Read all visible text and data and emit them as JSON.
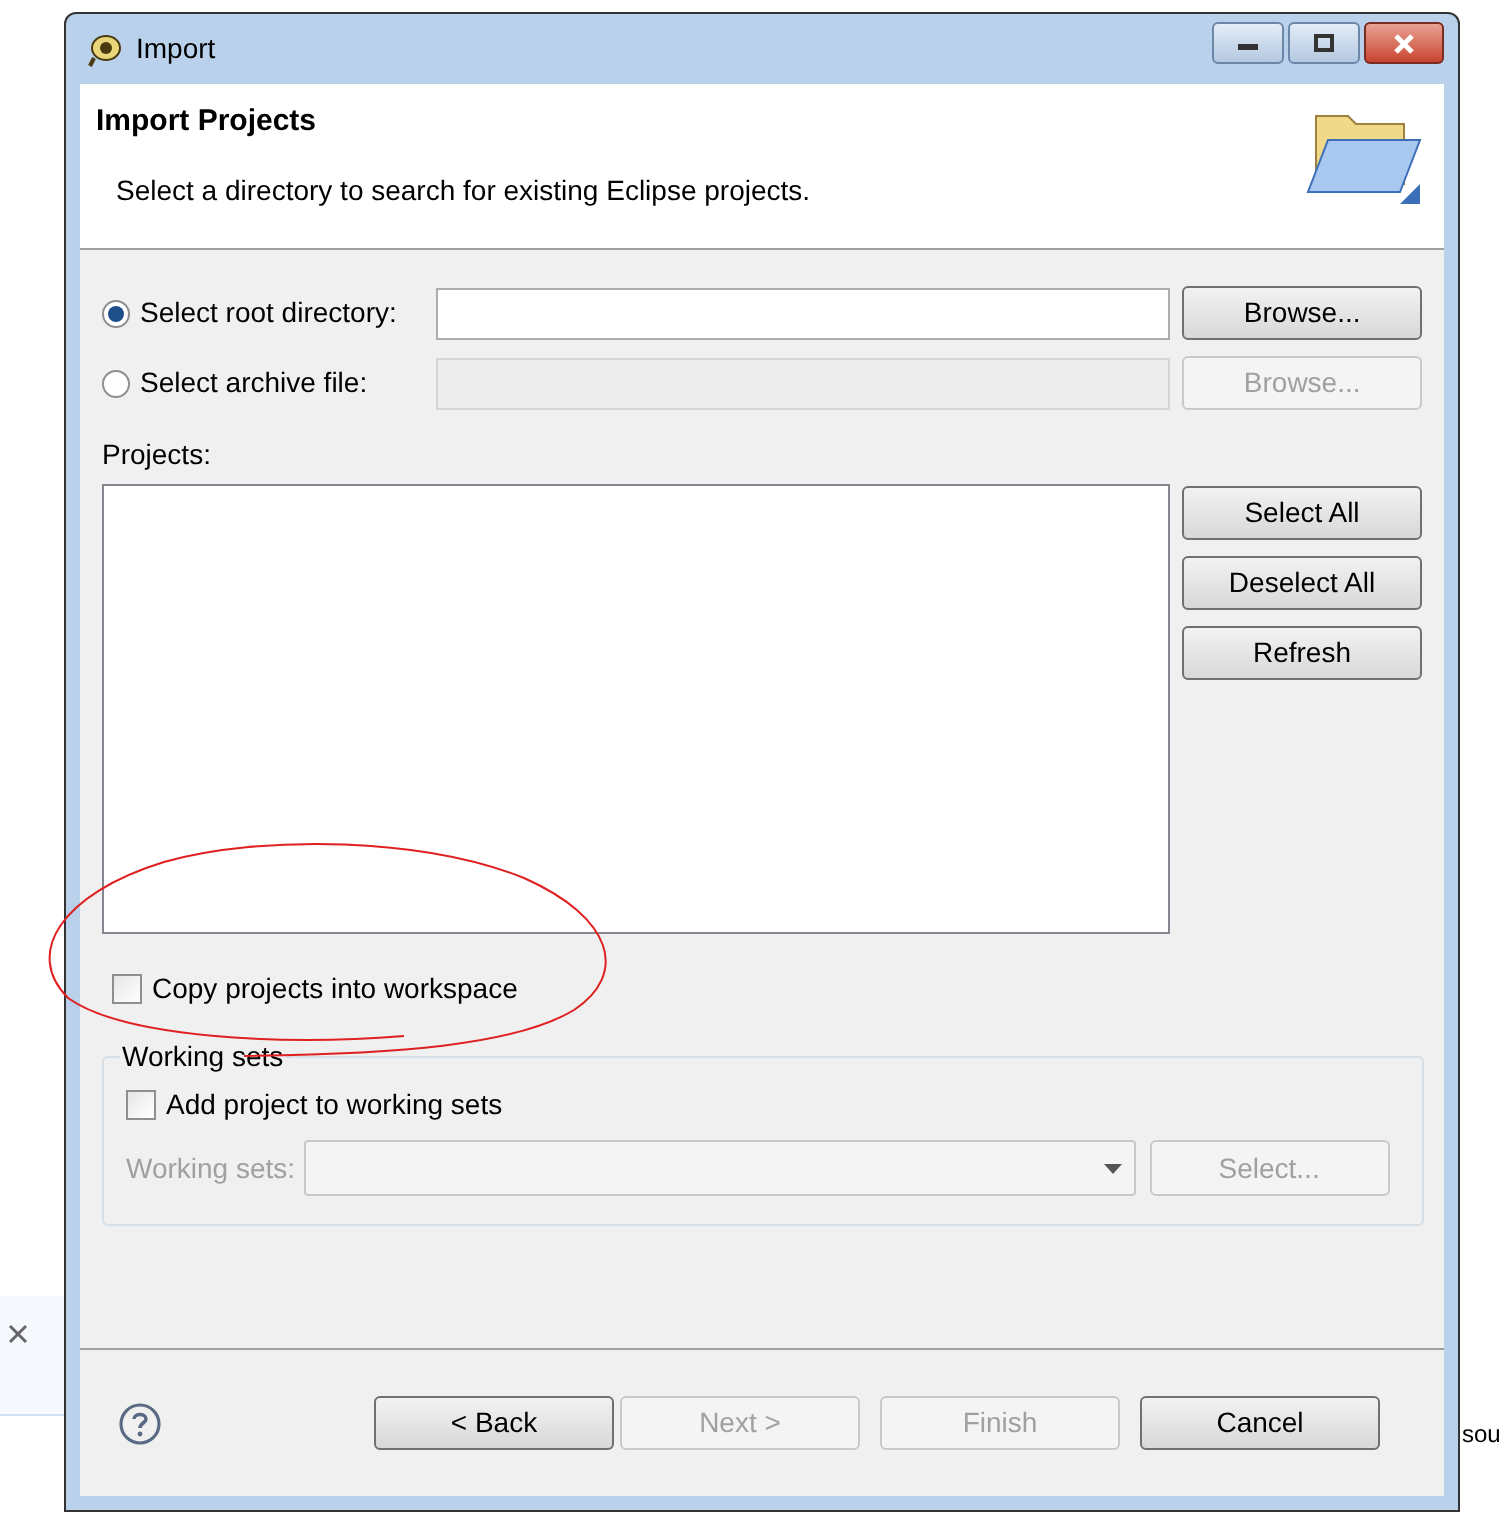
{
  "window": {
    "title": "Import"
  },
  "header": {
    "title": "Import Projects",
    "description": "Select a directory to search for existing Eclipse projects."
  },
  "sources": [
    {
      "label": "Select root directory:",
      "selected": true,
      "browse": {
        "label": "Browse...",
        "disabled": false
      }
    },
    {
      "label": "Select archive file:",
      "selected": false,
      "browse": {
        "label": "Browse...",
        "disabled": true
      }
    }
  ],
  "projects": {
    "label": "Projects:"
  },
  "project_buttons": [
    {
      "label": "Select All",
      "disabled": false
    },
    {
      "label": "Deselect All",
      "disabled": false
    },
    {
      "label": "Refresh",
      "disabled": false
    }
  ],
  "copy_projects": {
    "label": "Copy projects into workspace",
    "checked": false
  },
  "working_sets": {
    "title": "Working sets",
    "add_label": "Add project to working sets",
    "checked": false,
    "field_label": "Working sets:",
    "select_button": "Select..."
  },
  "footer_buttons": [
    {
      "label": "< Back",
      "disabled": false
    },
    {
      "label": "Next >",
      "disabled": true
    },
    {
      "label": "Finish",
      "disabled": true
    },
    {
      "label": "Cancel",
      "disabled": false
    }
  ],
  "background": {
    "text": "sou"
  }
}
